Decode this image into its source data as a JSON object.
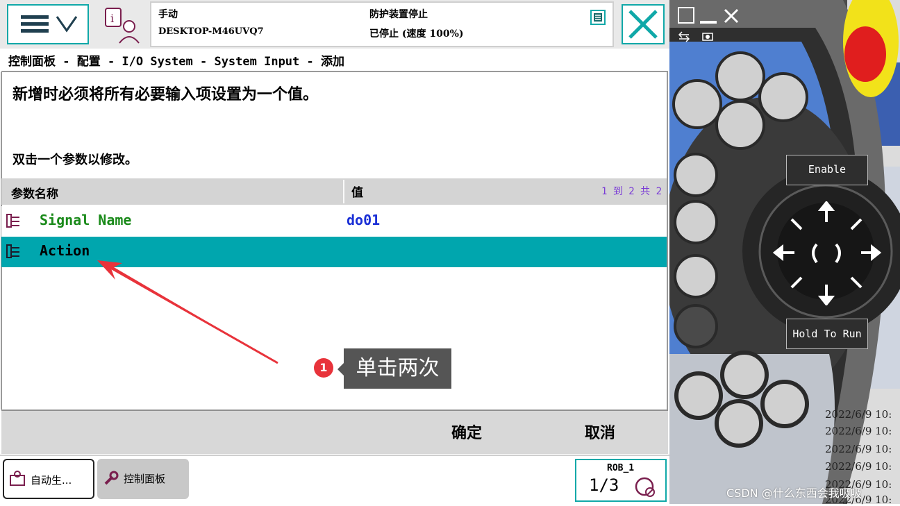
{
  "status": {
    "mode": "手动",
    "controller": "DESKTOP-M46UVQ7",
    "state": "防护装置停止",
    "speed": "已停止 (速度 100%)"
  },
  "breadcrumb": "控制面板 - 配置 - I/O System - System Input - 添加",
  "instructions": {
    "main": "新增时必须将所有必要输入项设置为一个值。",
    "hint": "双击一个参数以修改。"
  },
  "table": {
    "col_name": "参数名称",
    "col_value": "值",
    "count": "1 到 2 共 2",
    "rows": [
      {
        "name": "Signal Name",
        "value": "do01",
        "name_color": "#1a8a1a",
        "value_color": "#1a2fd6"
      },
      {
        "name": "Action",
        "value": "",
        "name_color": "#000000",
        "value_color": "#000000"
      }
    ]
  },
  "commands": {
    "ok": "确定",
    "cancel": "取消"
  },
  "taskbar": {
    "task1": "自动生...",
    "task2": "控制面板",
    "rob": "ROB_1",
    "fraction": "1/3"
  },
  "annotation": {
    "step": "1",
    "text": "单击两次"
  },
  "pendant": {
    "enable": "Enable",
    "hold_to_run": "Hold To Run"
  },
  "log_lines": [
    "2022/6/9 10:",
    "2022/6/9 10:",
    "2022/6/9 10:",
    "2022/6/9 10:",
    "2022/6/9 10:",
    "2022/6/9 10:"
  ],
  "watermark": "CSDN @什么东西会我吸吸",
  "colors": {
    "teal_accent": "#10a8a8",
    "selected_row": "#00a6ae",
    "annotation_red": "#e8333b",
    "joystick_blue": "#4f7fd0"
  }
}
